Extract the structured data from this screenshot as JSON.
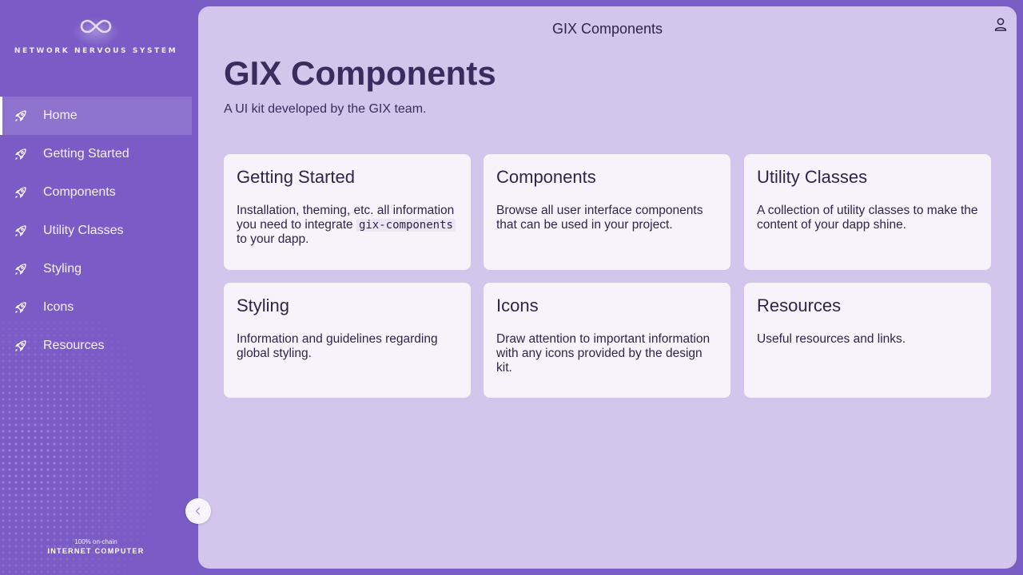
{
  "sidebar": {
    "logo_text": "NETWORK NERVOUS SYSTEM",
    "items": [
      {
        "label": "Home",
        "icon": "rocket-icon",
        "active": true
      },
      {
        "label": "Getting Started",
        "icon": "rocket-icon"
      },
      {
        "label": "Components",
        "icon": "rocket-icon"
      },
      {
        "label": "Utility Classes",
        "icon": "rocket-icon"
      },
      {
        "label": "Styling",
        "icon": "rocket-icon"
      },
      {
        "label": "Icons",
        "icon": "rocket-icon"
      },
      {
        "label": "Resources",
        "icon": "rocket-icon"
      }
    ],
    "footer_small": "100% on-chain",
    "footer_big": "INTERNET COMPUTER"
  },
  "header": {
    "title": "GIX Components",
    "user_icon": "user-icon"
  },
  "main": {
    "title": "GIX Components",
    "subtitle": "A UI kit developed by the GIX team.",
    "cards": [
      {
        "title": "Getting Started",
        "desc_before": "Installation, theming, etc. all information you need to integrate ",
        "code": "gix-components",
        "desc_after": " to your dapp."
      },
      {
        "title": "Components",
        "desc": "Browse all user interface components that can be used in your project."
      },
      {
        "title": "Utility Classes",
        "desc": "A collection of utility classes to make the content of your dapp shine."
      },
      {
        "title": "Styling",
        "desc": "Information and guidelines regarding global styling."
      },
      {
        "title": "Icons",
        "desc": "Draw attention to important information with any icons provided by the design kit."
      },
      {
        "title": "Resources",
        "desc": "Useful resources and links."
      }
    ]
  },
  "colors": {
    "sidebar_bg": "#7b5cc6",
    "main_bg": "#d2c6ec",
    "card_bg": "#f6f4fa",
    "text_dark": "#2e2548"
  }
}
